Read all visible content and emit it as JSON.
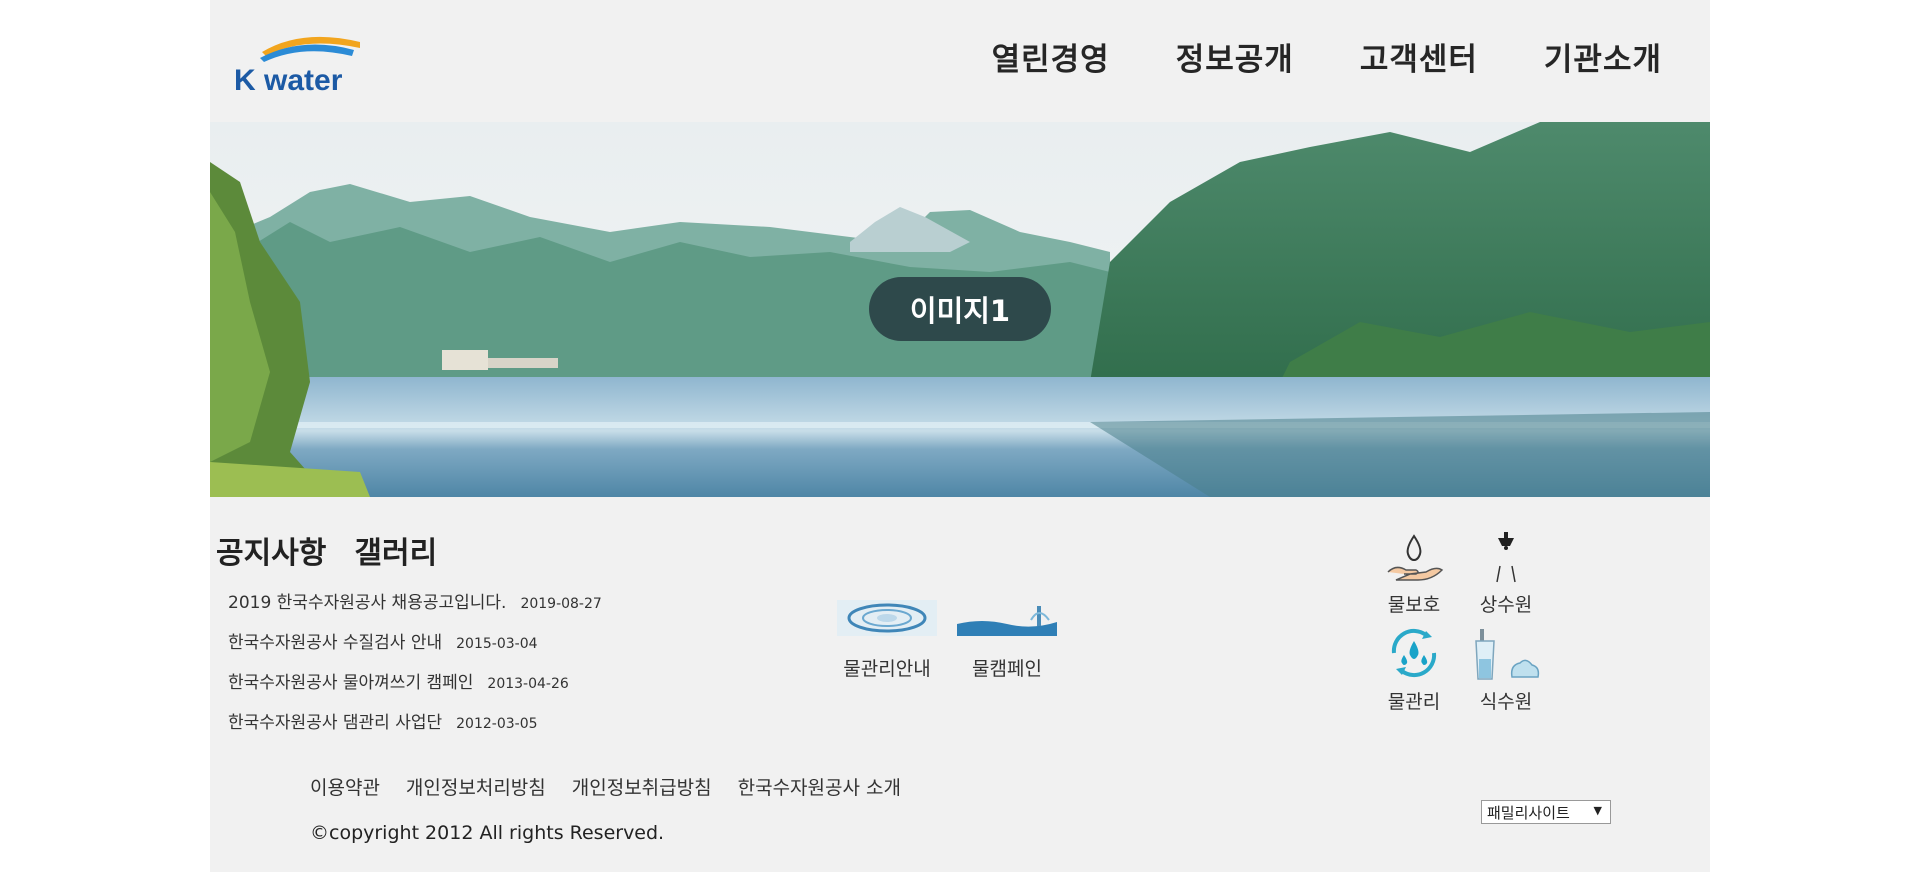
{
  "logo": {
    "brand_text": "K water"
  },
  "nav": {
    "items": [
      "열린경영",
      "정보공개",
      "고객센터",
      "기관소개"
    ]
  },
  "hero": {
    "slide_label": "이미지1"
  },
  "board": {
    "tabs": [
      "공지사항",
      "갤러리"
    ],
    "notices": [
      {
        "title": "2019 한국수자원공사 채용공고입니다.",
        "date": "2019-08-27"
      },
      {
        "title": "한국수자원공사 수질검사 안내",
        "date": "2015-03-04"
      },
      {
        "title": "한국수자원공사 물아껴쓰기 캠페인",
        "date": "2013-04-26"
      },
      {
        "title": "한국수자원공사 댐관리 사업단",
        "date": "2012-03-05"
      }
    ]
  },
  "quick_links": [
    {
      "label": "물관리안내",
      "icon": "water-swirl-icon"
    },
    {
      "label": "물캠페인",
      "icon": "water-splash-icon"
    }
  ],
  "icon_grid": [
    {
      "label": "물보호",
      "icon": "water-drop-hand-icon"
    },
    {
      "label": "상수원",
      "icon": "faucet-icon"
    },
    {
      "label": "물관리",
      "icon": "water-cycle-icon"
    },
    {
      "label": "식수원",
      "icon": "water-glass-icon"
    }
  ],
  "footer": {
    "links": [
      "이용약관",
      "개인정보처리방침",
      "개인정보취급방침",
      "한국수자원공사 소개"
    ],
    "copyright": "©copyright 2012 All rights Reserved.",
    "family_site": "패밀리사이트",
    "family_arrow": "▼"
  },
  "colors": {
    "background": "#f1f1f1",
    "accent_blue": "#1f5ea8",
    "accent_orange": "#f29c1f"
  }
}
